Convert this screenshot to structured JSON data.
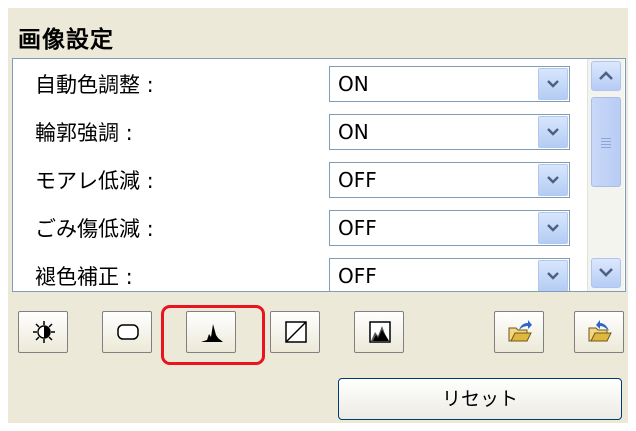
{
  "panel": {
    "title": "画像設定"
  },
  "settings": [
    {
      "label": "自動色調整 :",
      "value": "ON"
    },
    {
      "label": "輪郭強調 :",
      "value": "ON"
    },
    {
      "label": "モアレ低減 :",
      "value": "OFF"
    },
    {
      "label": "ごみ傷低減 :",
      "value": "OFF"
    },
    {
      "label": "褪色補正 :",
      "value": "OFF"
    }
  ],
  "toolbar": {
    "icons": [
      "brightness-icon",
      "rounded-rect-icon",
      "histogram-icon",
      "tone-curve-icon",
      "final-review-icon",
      "load-settings-icon",
      "save-settings-icon"
    ],
    "selected": "histogram-icon"
  },
  "reset_label": "リセット",
  "colors": {
    "panel_bg": "#ece9d8",
    "highlight": "#e8141e",
    "field_border": "#7f9db9"
  }
}
